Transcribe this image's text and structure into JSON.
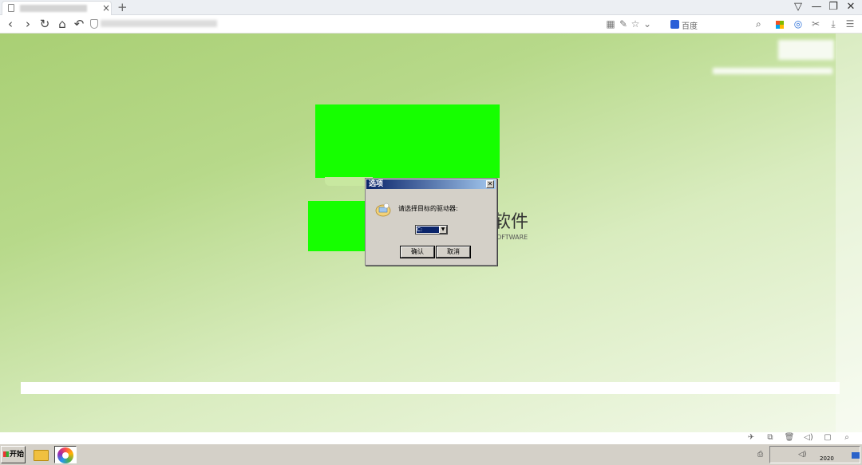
{
  "browser": {
    "tab": {
      "close_glyph": "×"
    },
    "new_tab_glyph": "+",
    "window_controls": {
      "minimize": "—",
      "restore": "❐",
      "close": "✕",
      "skin": "▽"
    },
    "nav": {
      "back": "‹",
      "forward": "›",
      "refresh": "↻",
      "home": "⌂",
      "undo": "↶"
    },
    "toolbar_icons": {
      "qr": "▦",
      "reader": "✎",
      "star": "☆",
      "dropdown": "⌄",
      "scissors": "✂",
      "download": "⤓",
      "menu": "☰",
      "extension": "◎"
    },
    "search": {
      "engine": "百度",
      "icon": "search-icon"
    },
    "ms_colors": [
      "#f25022",
      "#7fba00",
      "#00a4ef",
      "#ffb900"
    ]
  },
  "page": {
    "title_cn_suffix": "软件",
    "title_en_suffix": "OFTWARE",
    "accent_green": "#16ff00"
  },
  "dialog": {
    "title": "选项",
    "close_glyph": "✕",
    "prompt": "请选择目标的驱动器:",
    "select_value": "C:",
    "select_arrow": "▼",
    "ok_label": "确认",
    "cancel_label": "取消"
  },
  "statusbar": {
    "icons": [
      "rocket-icon",
      "copy-icon",
      "trash-icon",
      "volume-icon",
      "window-icon",
      "zoom-icon"
    ],
    "glyphs": [
      "✈",
      "⧉",
      "🗑",
      "◁)",
      "▢",
      "⌕"
    ]
  },
  "taskbar": {
    "start_label": "开始",
    "tray_clock": "2020"
  }
}
